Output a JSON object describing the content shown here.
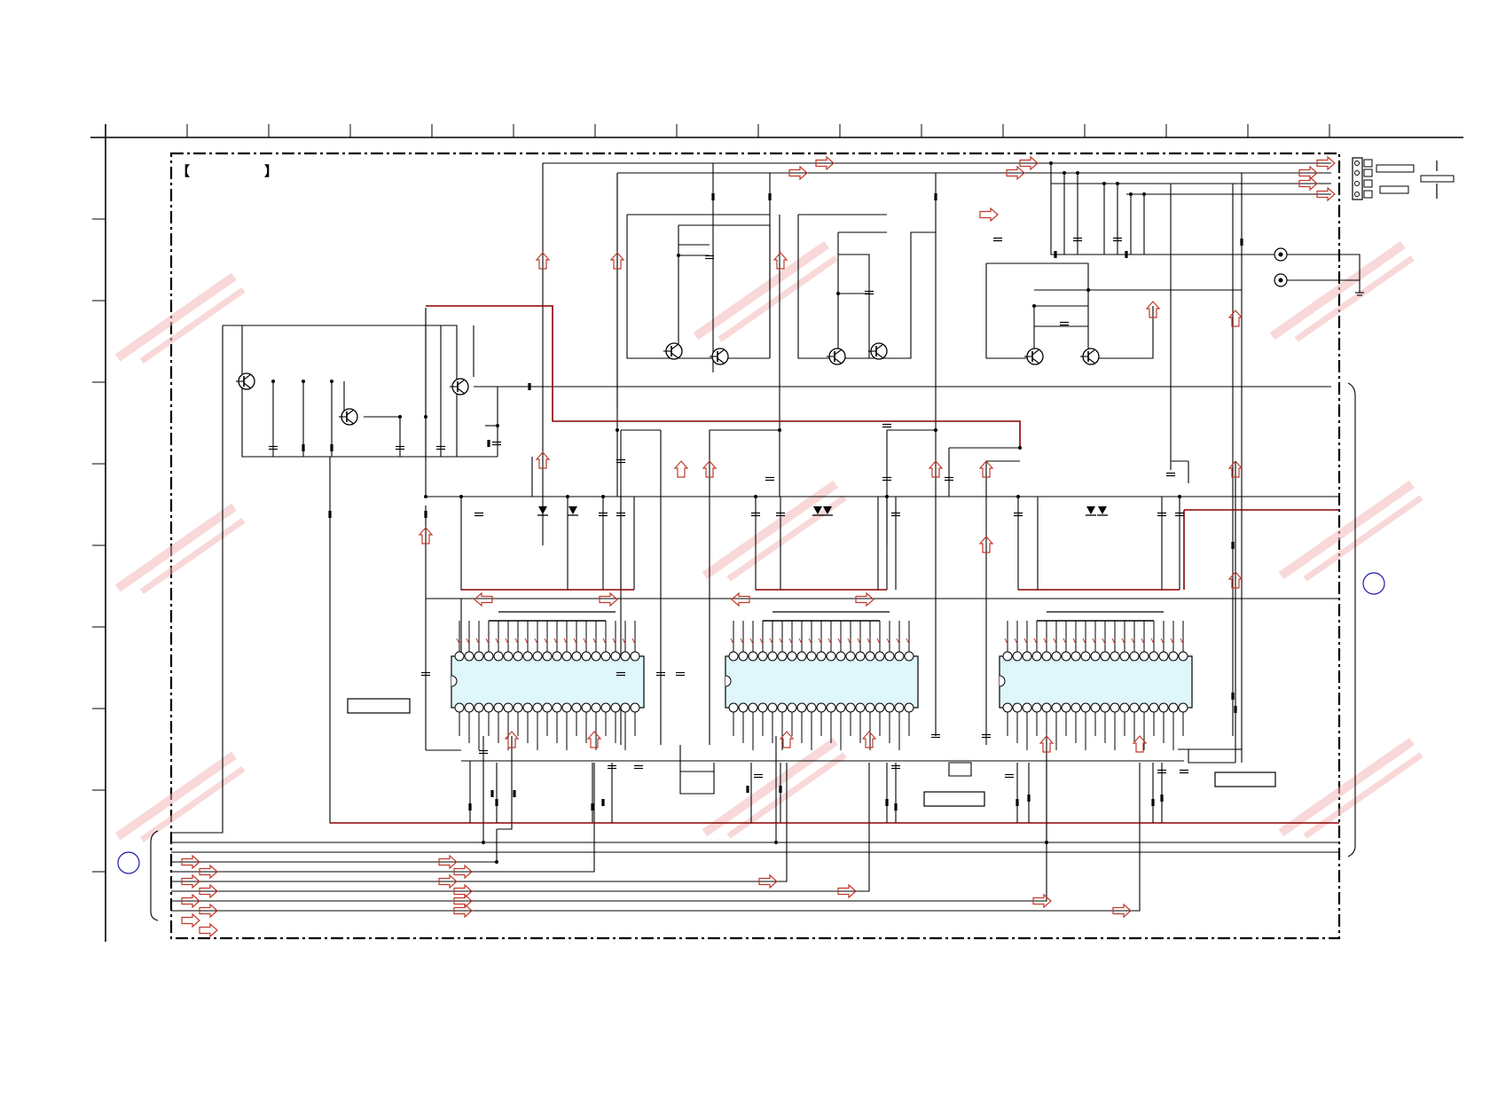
{
  "sheet": {
    "title_bracket_open": "【",
    "title_bracket_close": "】"
  },
  "colors": {
    "wire": "#000000",
    "wire_highlight": "#8b0000",
    "signal_arrow": "#c0392b",
    "ic_body_fill": "#dff6fb",
    "ic_pin_fill": "#ffffff",
    "reference_circle": "#1a1aa6",
    "watermark": "#f2b8b8"
  },
  "icons": {
    "signal_arrow": "signal-flow-arrow-icon",
    "transistor": "transistor-symbol-icon",
    "diode": "diode-symbol-icon",
    "capacitor": "capacitor-symbol-icon",
    "resistor": "resistor-symbol-icon",
    "connector_jack": "jack-connector-icon",
    "ground": "ground-symbol-icon"
  }
}
